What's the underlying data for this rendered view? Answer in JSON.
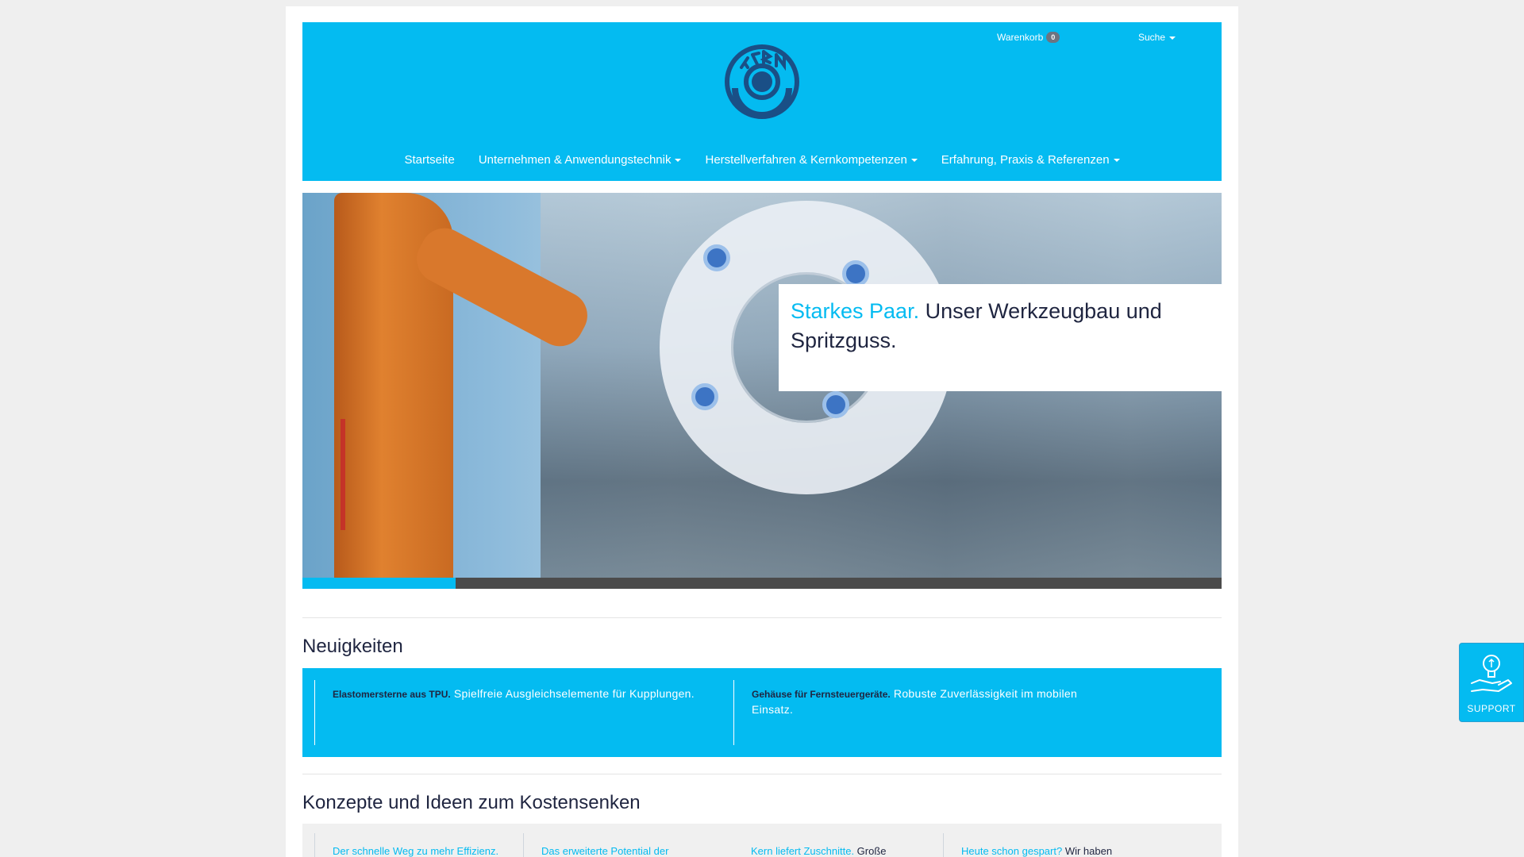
{
  "header": {
    "cart_label": "Warenkorb",
    "cart_count": "0",
    "search_label": "Suche",
    "logo_name": "kern-logo",
    "nav": [
      {
        "label": "Startseite",
        "dropdown": false
      },
      {
        "label": "Unternehmen & Anwendungstechnik",
        "dropdown": true
      },
      {
        "label": "Herstellverfahren & Kernkompetenzen",
        "dropdown": true
      },
      {
        "label": "Erfahrung, Praxis & Referenzen",
        "dropdown": true
      }
    ]
  },
  "hero": {
    "caption_accent": "Starkes Paar.",
    "caption_text": " Unser Werkzeugbau und Spritzguss.",
    "slide_progress": 0.1667
  },
  "news": {
    "title": "Neuigkeiten",
    "items": [
      {
        "title": "Elastomersterne aus TPU.",
        "text": " Spielfreie Ausgleichselemente für Kupplungen."
      },
      {
        "title": "Gehäuse für Fernsteuergeräte.",
        "text": " Robuste Zuverlässigkeit im mobilen Einsatz."
      }
    ]
  },
  "concepts": {
    "title": "Konzepte und Ideen zum Kostensenken",
    "items": [
      {
        "link": "Der schnelle Weg zu mehr Effizienz.",
        "text": ""
      },
      {
        "link": "Das erweiterte Potential der",
        "text": ""
      },
      {
        "link": "Kern liefert Zuschnitte.",
        "text": " Große"
      },
      {
        "link": "Heute schon gespart?",
        "text": " Wir haben"
      }
    ]
  },
  "support": {
    "label": "SUPPORT",
    "icon": "lightbulb-hand-icon"
  },
  "colors": {
    "brand": "#04bbf1",
    "text": "#1f2540",
    "progress_track": "#4b4b4b"
  }
}
